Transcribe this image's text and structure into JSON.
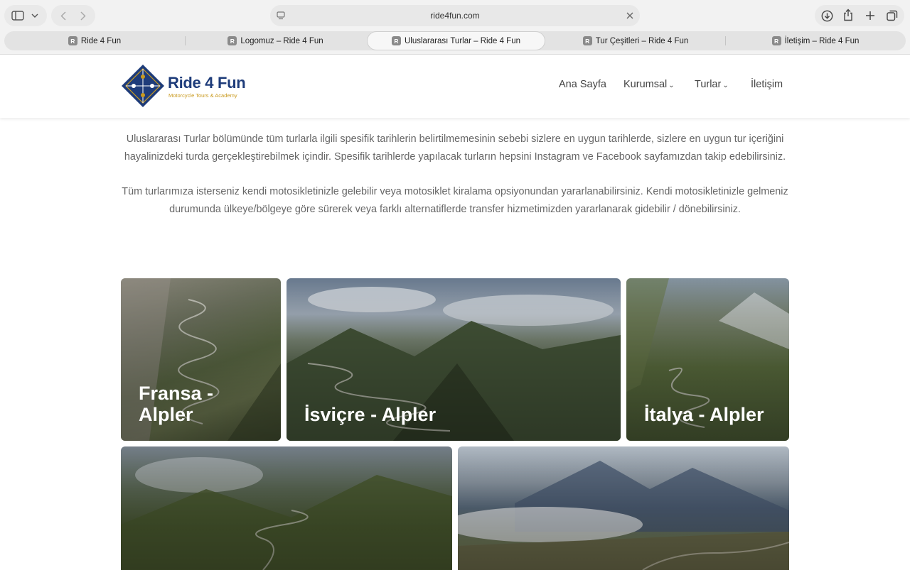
{
  "browser": {
    "url": "ride4fun.com",
    "tabs": [
      {
        "label": "Ride 4 Fun",
        "favicon": "R"
      },
      {
        "label": "Logomuz – Ride 4 Fun",
        "favicon": "R"
      },
      {
        "label": "Uluslararası Turlar – Ride 4 Fun",
        "favicon": "R"
      },
      {
        "label": "Tur Çeşitleri – Ride 4 Fun",
        "favicon": "R"
      },
      {
        "label": "İletişim – Ride 4 Fun",
        "favicon": "R"
      }
    ],
    "active_tab": 2
  },
  "site": {
    "logo": {
      "name": "Ride 4 Fun",
      "tagline": "Motorcycle Tours & Academy"
    },
    "nav": [
      {
        "label": "Ana Sayfa"
      },
      {
        "label": "Kurumsal",
        "dropdown_icon": "⌄"
      },
      {
        "label": "Turlar",
        "dropdown_icon": "⌄"
      },
      {
        "label": "İletişim"
      }
    ]
  },
  "content": {
    "paragraph1_line1": "Uluslararası Turlar bölümünde tüm turlarla ilgili spesifik tarihlerin belirtilmemesinin sebebi sizlere en uygun tarihlerde, sizlere en uygun tur içeriğini",
    "paragraph1_line2": "hayalinizdeki turda gerçekleştirebilmek içindir. Spesifik tarihlerde yapılacak turların hepsini Instagram ve Facebook sayfamızdan takip edebilirsiniz.",
    "paragraph2_line1": "Tüm turlarımıza isterseniz kendi motosikletinizle gelebilir veya motosiklet kiralama opsiyonundan yararlanabilirsiniz. Kendi motosikletinizle gelmeniz",
    "paragraph2_line2": "durumunda ülkeye/bölgeye göre sürerek veya farklı alternatiflerde transfer hizmetimizden yararlanarak gidebilir / dönebilirsiniz."
  },
  "tours": [
    {
      "title_line1": "Fransa -",
      "title_line2": "Alpler"
    },
    {
      "title": "İsviçre - Alpler"
    },
    {
      "title": "İtalya - Alpler"
    },
    {
      "title": ""
    },
    {
      "title": ""
    }
  ],
  "colors": {
    "brand_blue": "#1e3c7a",
    "brand_gold": "#c99a1f",
    "text_gray": "#666666"
  }
}
